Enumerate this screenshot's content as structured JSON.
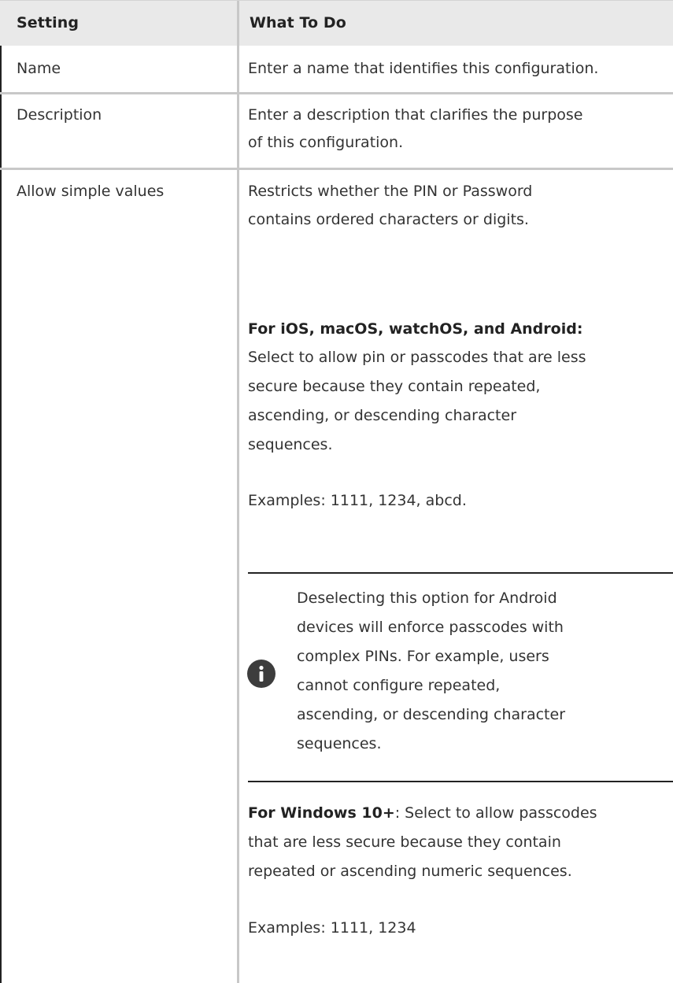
{
  "table": {
    "headers": {
      "setting": "Setting",
      "what_to_do": "What To Do"
    },
    "rows": [
      {
        "setting": "Name",
        "what_to_do": "Enter a name that identifies this configuration."
      },
      {
        "setting": "Description",
        "what_to_do_lines": [
          "Enter a description that clarifies the purpose",
          "of this configuration."
        ]
      },
      {
        "setting": "Allow simple values",
        "intro_lines": [
          "Restricts whether the PIN or Password",
          "contains ordered characters or digits."
        ],
        "apple_android_heading": "For iOS, macOS, watchOS, and Android:",
        "apple_android_lines": [
          "Select to allow  pin or passcodes that are less",
          "secure because they contain repeated,",
          "ascending, or descending character",
          "sequences."
        ],
        "apple_android_examples": "Examples: 1111, 1234, abcd.",
        "note": {
          "icon": "info-icon",
          "lines": [
            "Deselecting this option for Android",
            "devices will enforce passcodes with",
            "complex PINs. For example, users",
            "cannot configure repeated,",
            "ascending, or descending character",
            "sequences."
          ]
        },
        "windows_heading": "For Windows 10+",
        "windows_first_line_rest": ": Select to allow passcodes",
        "windows_lines": [
          "that are less secure because they contain",
          "repeated or ascending numeric sequences."
        ],
        "windows_examples": "Examples: 1111, 1234"
      }
    ]
  }
}
